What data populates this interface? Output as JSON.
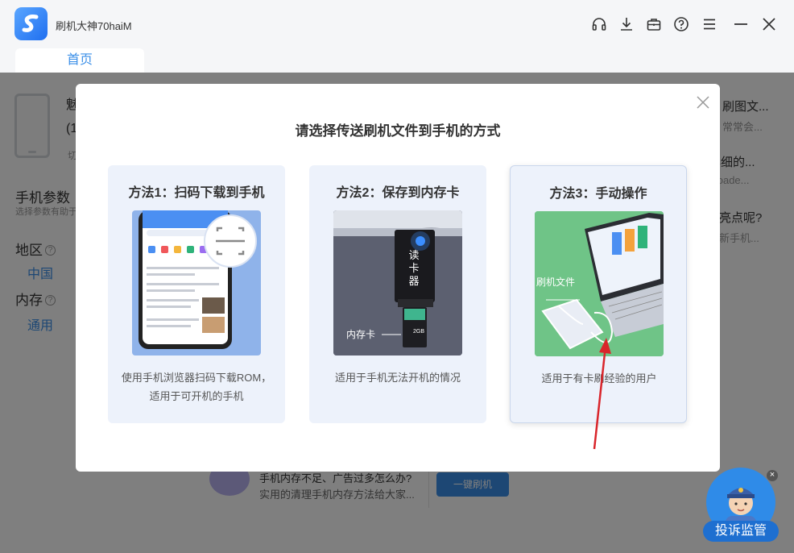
{
  "app": {
    "title": "刷机大神70haiM",
    "tab": "首页"
  },
  "toolbar": {
    "icons": [
      "headset-icon",
      "download-icon",
      "toolbox-icon",
      "help-icon",
      "menu-icon",
      "minimize-icon",
      "close-icon"
    ]
  },
  "background": {
    "device_name_partial": "魅",
    "device_sub_partial": "(1",
    "device_switch_partial": "切",
    "params_title": "手机参数",
    "params_subtitle": "选择参数有助于",
    "region_label": "地区",
    "region_value": "中国",
    "storage_label": "内存",
    "storage_value": "通用",
    "news": [
      {
        "title": "刷图文...",
        "sub": "常常会..."
      },
      {
        "title": "详细的...",
        "sub": "otloade..."
      },
      {
        "title": "亮点呢?",
        "sub": "新手机..."
      }
    ],
    "tip_title": "手机内存不足、广告过多怎么办?",
    "tip_sub": "实用的清理手机内存方法给大家...",
    "flash_button": "一键刷机"
  },
  "complaint": {
    "label": "投诉监管",
    "close": "×"
  },
  "modal": {
    "title": "请选择传送刷机文件到手机的方式",
    "options": [
      {
        "title": "方法1：扫码下载到手机",
        "desc_line1": "使用手机浏览器扫码下载ROM，",
        "desc_line2": "适用于可开机的手机"
      },
      {
        "title": "方法2：保存到内存卡",
        "desc_line1": "适用于手机无法开机的情况",
        "desc_line2": "",
        "reader_label": "读卡器",
        "card_label": "内存卡",
        "card_size": "2GB"
      },
      {
        "title": "方法3：手动操作",
        "desc_line1": "适用于有卡刷经验的用户",
        "desc_line2": "",
        "file_label": "刷机文件"
      }
    ]
  },
  "colors": {
    "accent": "#3b8fe8",
    "option_bg": "#edf2fb",
    "annotation_arrow": "#d9252b"
  }
}
